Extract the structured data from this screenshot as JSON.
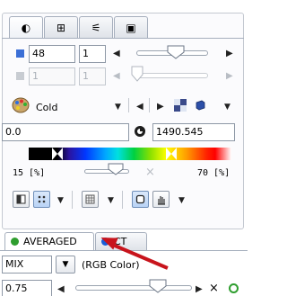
{
  "tabs": [
    {
      "icon": "contrast-icon",
      "glyph": "◐"
    },
    {
      "icon": "grid-icon",
      "glyph": "⊞"
    },
    {
      "icon": "sliders-icon",
      "glyph": "⚟"
    },
    {
      "icon": "save-icon",
      "glyph": "▣"
    }
  ],
  "slice1": {
    "start": "48",
    "step": "1",
    "slider_position": 0.6
  },
  "slice2": {
    "start": "1",
    "step": "1",
    "slider_position": 0.02
  },
  "colormap": {
    "name": "Cold"
  },
  "range": {
    "min": "0.0",
    "max": "1490.545"
  },
  "threshold": {
    "lower": "15 [%]",
    "upper": "70 [%]",
    "cross": "×"
  },
  "bottom_tabs": [
    {
      "label": "AVERAGED",
      "color": "#2f9e2f"
    },
    {
      "label": "CT",
      "color": "#1a5ed8"
    }
  ],
  "fusion": {
    "mode": "MIX",
    "mode_desc": "(RGB Color)",
    "alpha": "0.75",
    "close": "×"
  },
  "colors": {
    "accent_blue": "#3b6fd6",
    "arrow": "#c8141c"
  }
}
